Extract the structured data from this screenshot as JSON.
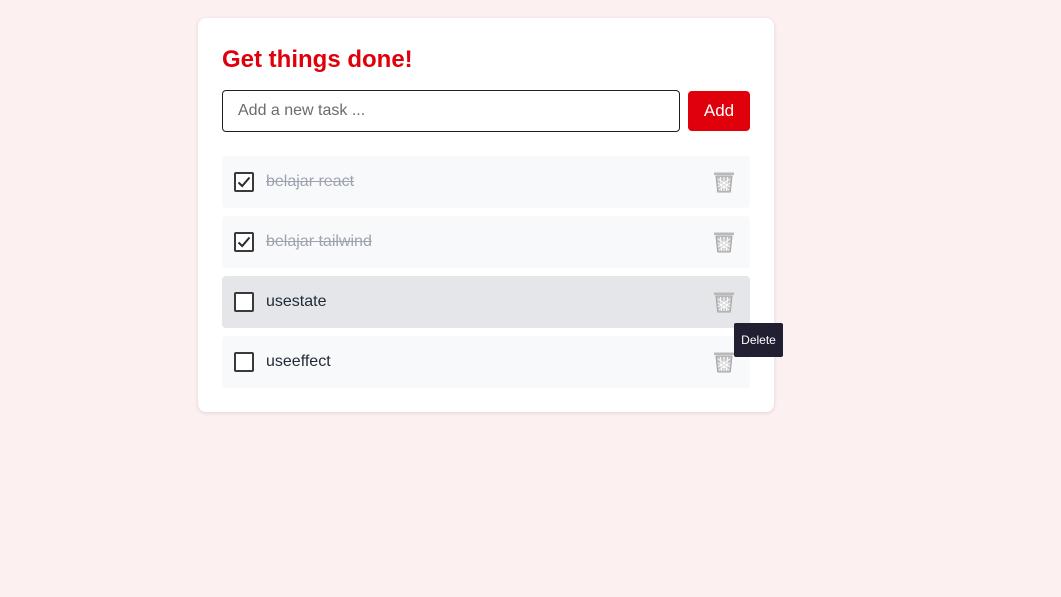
{
  "app": {
    "title": "Get things done!"
  },
  "form": {
    "placeholder": "Add a new task ...",
    "value": "",
    "add_label": "Add"
  },
  "tasks": [
    {
      "label": "belajar react",
      "done": true
    },
    {
      "label": "belajar tailwind",
      "done": true
    },
    {
      "label": "usestate",
      "done": false,
      "hovered": true
    },
    {
      "label": "useeffect",
      "done": false
    }
  ],
  "tooltip": {
    "text": "Delete"
  },
  "icons": {
    "checkbox": "checkmark-icon",
    "delete": "trash-icon"
  },
  "colors": {
    "accent": "#e0000b",
    "background": "#fdf0f0",
    "tooltip_bg": "#231f33"
  }
}
